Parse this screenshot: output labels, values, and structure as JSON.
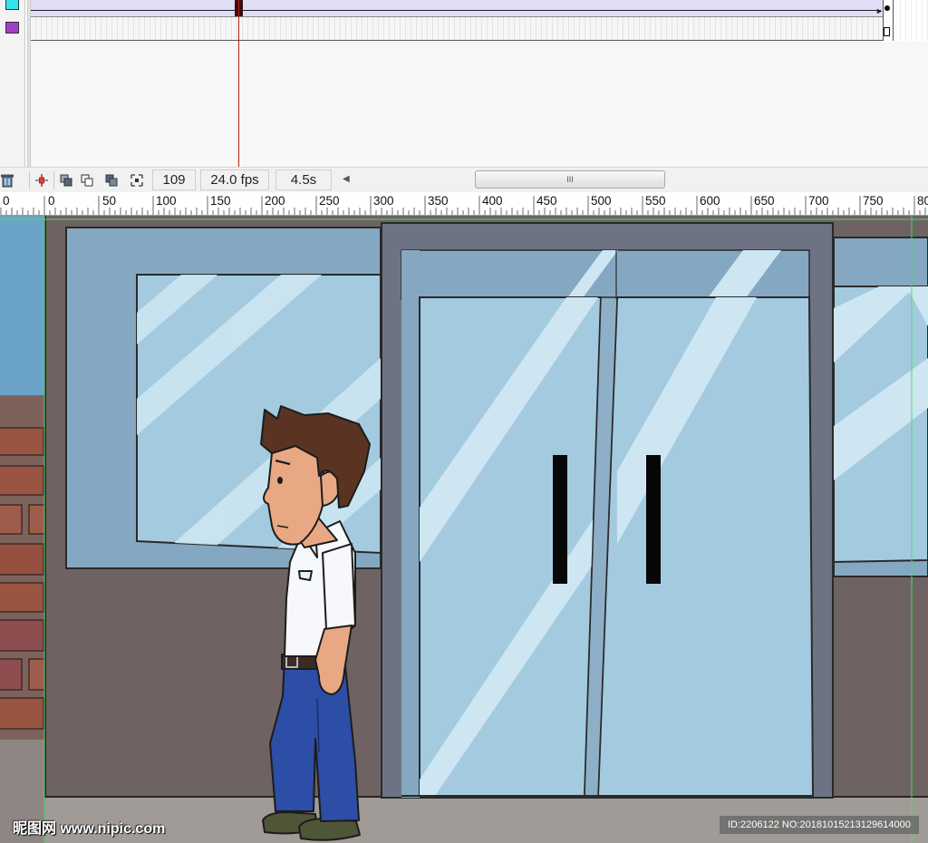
{
  "timeline": {
    "current_frame": "109",
    "frame_rate": "24.0 fps",
    "elapsed_time": "4.5s",
    "layers": [
      {
        "color": "#35e3ea"
      },
      {
        "color": "#a040c8"
      }
    ],
    "icons": {
      "delete": "trash-icon",
      "center_frame": "center-frame-icon",
      "onion_skin": "onion-skin-icon",
      "onion_skin_outlines": "onion-skin-outlines-icon",
      "edit_multiple_frames": "edit-multiple-frames-icon",
      "modify_markers": "modify-onion-markers-icon",
      "scroll_left": "scroll-left-arrow-icon",
      "scroll_grip": "scroll-grip-icon"
    },
    "scroll_grip_text": "III"
  },
  "ruler": {
    "labels": [
      "0",
      "0",
      "50",
      "100",
      "150",
      "200",
      "250",
      "300",
      "350",
      "400",
      "450",
      "500",
      "550",
      "600",
      "650",
      "700",
      "750",
      "80"
    ]
  },
  "watermark": {
    "left": "昵图网 www.nipic.com",
    "right": "ID:2206122 NO:20181015213129614000"
  },
  "colors": {
    "wall": "#6e6362",
    "window_glass": "#a4cae0",
    "window_frame": "#84a8c2",
    "door_frame": "#6e7384",
    "sidewalk": "#a09b97",
    "shirt": "#f6f8fb",
    "pants": "#2c4ea6",
    "hair": "#5a3322",
    "skin": "#e8a883",
    "guide_line": "#4ed86a",
    "playhead": "#b5221a"
  }
}
